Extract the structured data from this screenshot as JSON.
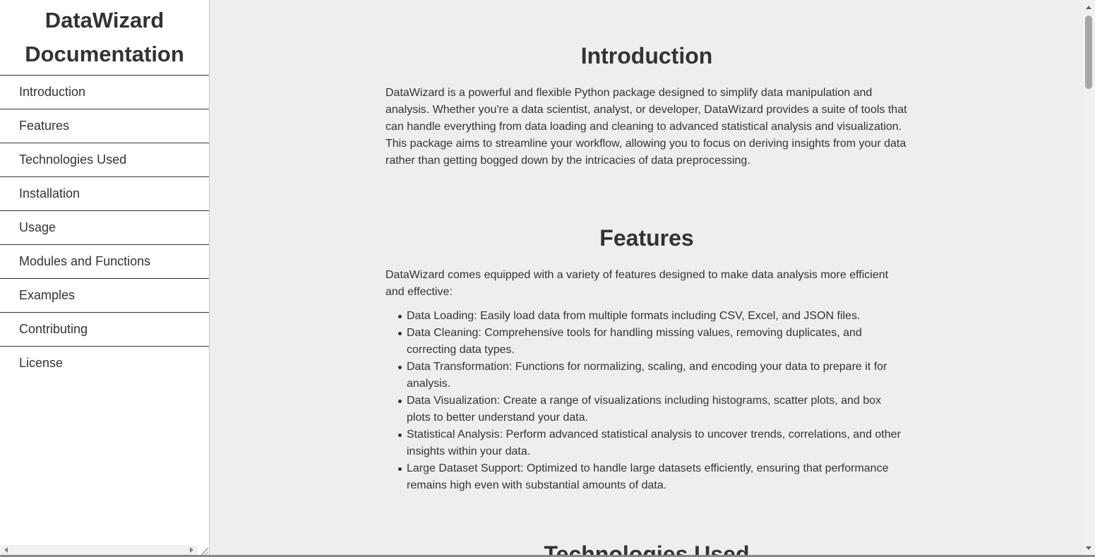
{
  "sidebar": {
    "title": "DataWizard Documentation",
    "items": [
      {
        "label": "Introduction"
      },
      {
        "label": "Features"
      },
      {
        "label": "Technologies Used"
      },
      {
        "label": "Installation"
      },
      {
        "label": "Usage"
      },
      {
        "label": "Modules and Functions"
      },
      {
        "label": "Examples"
      },
      {
        "label": "Contributing"
      },
      {
        "label": "License"
      }
    ]
  },
  "main": {
    "introduction": {
      "heading": "Introduction",
      "body": "DataWizard is a powerful and flexible Python package designed to simplify data manipulation and analysis. Whether you're a data scientist, analyst, or developer, DataWizard provides a suite of tools that can handle everything from data loading and cleaning to advanced statistical analysis and visualization. This package aims to streamline your workflow, allowing you to focus on deriving insights from your data rather than getting bogged down by the intricacies of data preprocessing."
    },
    "features": {
      "heading": "Features",
      "body": "DataWizard comes equipped with a variety of features designed to make data analysis more efficient and effective:",
      "items": [
        "Data Loading: Easily load data from multiple formats including CSV, Excel, and JSON files.",
        "Data Cleaning: Comprehensive tools for handling missing values, removing duplicates, and correcting data types.",
        "Data Transformation: Functions for normalizing, scaling, and encoding your data to prepare it for analysis.",
        "Data Visualization: Create a range of visualizations including histograms, scatter plots, and box plots to better understand your data.",
        "Statistical Analysis: Perform advanced statistical analysis to uncover trends, correlations, and other insights within your data.",
        "Large Dataset Support: Optimized to handle large datasets efficiently, ensuring that performance remains high even with substantial amounts of data."
      ]
    },
    "technologies": {
      "heading": "Technologies Used"
    }
  },
  "colors": {
    "text": "#333333",
    "main_background": "#eeeeee",
    "sidebar_background": "#ffffff"
  }
}
